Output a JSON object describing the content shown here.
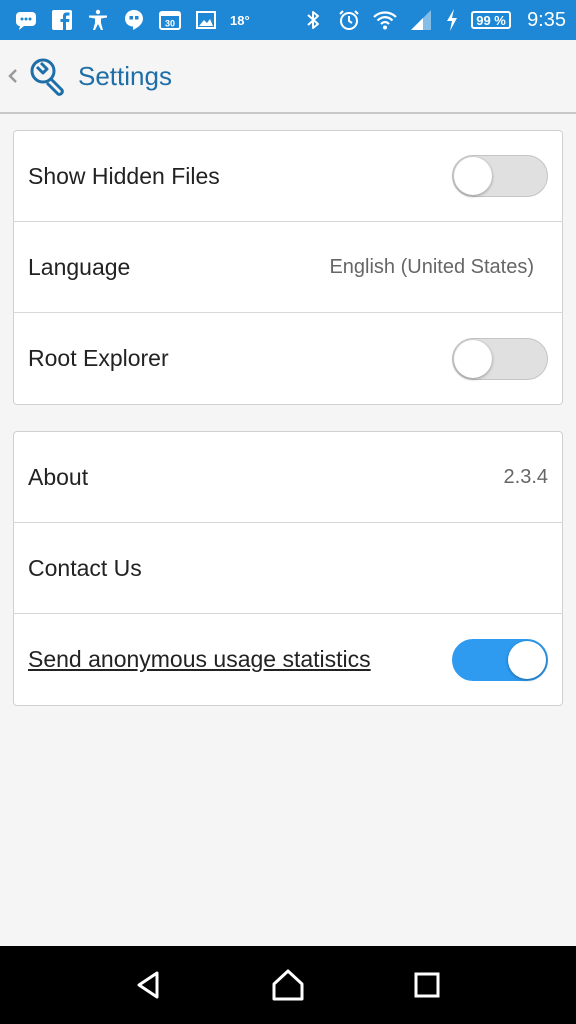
{
  "status_bar": {
    "temperature": "18°",
    "battery": "99 %",
    "time": "9:35",
    "icons": [
      "chat-icon",
      "facebook-icon",
      "accessibility-icon",
      "hangouts-icon",
      "calendar-icon",
      "image-icon",
      "bluetooth-icon",
      "alarm-icon",
      "wifi-icon",
      "signal-icon",
      "charging-icon"
    ]
  },
  "app_bar": {
    "title": "Settings",
    "icon": "wrench-search-icon"
  },
  "settings_group_1": [
    {
      "label": "Show Hidden Files",
      "type": "toggle",
      "checked": false
    },
    {
      "label": "Language",
      "type": "value",
      "value": "English (United States)"
    },
    {
      "label": "Root Explorer",
      "type": "toggle",
      "checked": false
    }
  ],
  "settings_group_2": [
    {
      "label": "About",
      "type": "value",
      "value": "2.3.4"
    },
    {
      "label": "Contact Us",
      "type": "none"
    },
    {
      "label": "Send anonymous usage statistics",
      "type": "toggle",
      "checked": true
    }
  ],
  "colors": {
    "status_bar": "#1e88d6",
    "title": "#1e6ea8",
    "toggle_on": "#2f9bf0"
  },
  "nav_bar": {
    "buttons": [
      "back-icon",
      "home-icon",
      "recents-icon"
    ]
  }
}
